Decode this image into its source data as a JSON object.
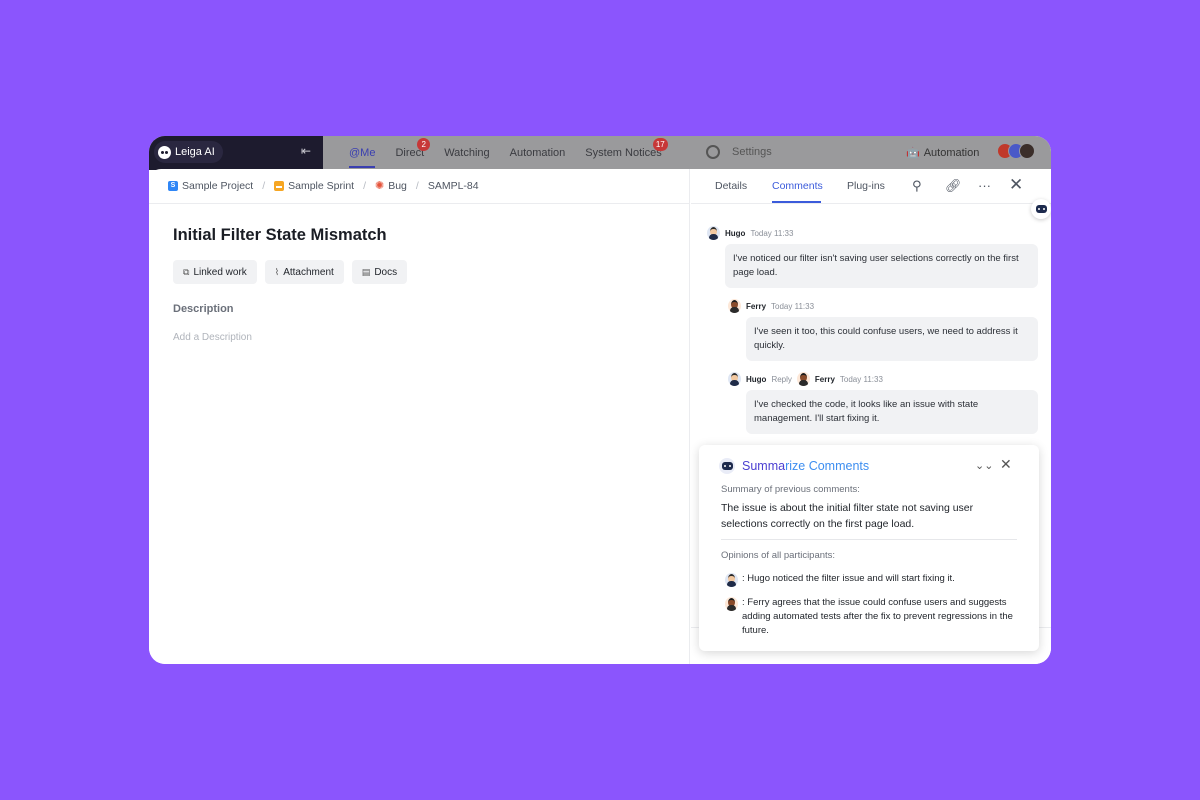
{
  "appbar": {
    "ai_label": "Leiga AI",
    "nav": [
      {
        "label": "@Me",
        "badge": ""
      },
      {
        "label": "Direct",
        "badge": "2"
      },
      {
        "label": "Watching",
        "badge": ""
      },
      {
        "label": "Automation",
        "badge": ""
      },
      {
        "label": "System Notices",
        "badge": "17"
      }
    ],
    "settings_label": "Settings",
    "automation_label": "Automation"
  },
  "breadcrumb": {
    "project": "Sample Project",
    "sprint": "Sample Sprint",
    "type": "Bug",
    "key": "SAMPL-84"
  },
  "issue": {
    "title": "Initial Filter State Mismatch",
    "chips": [
      "Linked work",
      "Attachment",
      "Docs"
    ],
    "description_label": "Description",
    "description_placeholder": "Add a Description"
  },
  "tabs": [
    "Details",
    "Comments",
    "Plug-ins"
  ],
  "comments": [
    {
      "author": "Hugo",
      "time": "Today 11:33",
      "text": "I've noticed our filter isn't saving user selections correctly on the first page load."
    },
    {
      "author": "Ferry",
      "time": "Today 11:33",
      "text": "I've seen it too, this could confuse users, we need to address it quickly."
    },
    {
      "author": "Hugo",
      "reply_label": "Reply",
      "reply_to": "Ferry",
      "time": "Today 11:33",
      "text": "I've checked the code, it looks like an issue with state management. I'll start fixing it."
    }
  ],
  "summary": {
    "title_part1": "Summa",
    "title_part2": "rize Comments",
    "summary_label": "Summary of previous comments:",
    "summary_text": "The issue is about the initial filter state not saving user selections correctly on the first page load.",
    "opinions_label": "Opinions of all participants:",
    "opinions": [
      ": Hugo noticed the filter issue and will start fixing it.",
      ": Ferry agrees that the issue could confuse users and suggests adding automated tests after the fix to prevent regressions in the future."
    ]
  },
  "colors": {
    "background": "#8b55fd",
    "accent": "#3b5bdb",
    "summary_purple": "#4b3fd1",
    "summary_blue": "#3d8ef0"
  }
}
